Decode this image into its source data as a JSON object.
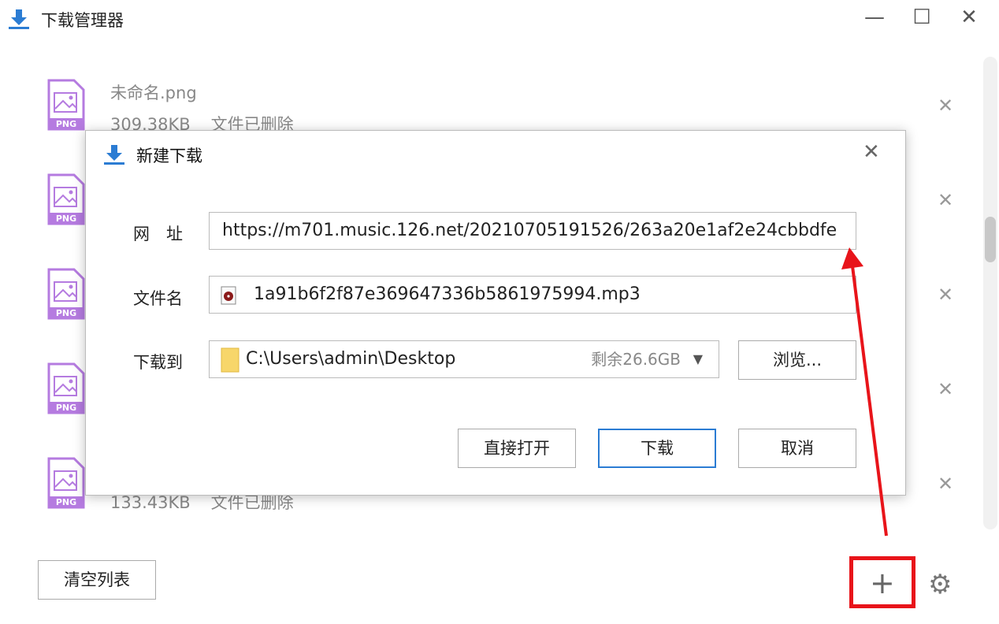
{
  "window": {
    "title": "下载管理器",
    "icon": "download-icon",
    "controls": [
      "minimize-icon",
      "maximize-icon",
      "close-icon"
    ]
  },
  "list": [
    {
      "name": "未命名.png",
      "size": "309.38KB",
      "status": "文件已删除",
      "type": "PNG"
    },
    {
      "name": "",
      "size": "",
      "status": "",
      "type": "PNG"
    },
    {
      "name": "",
      "size": "",
      "status": "",
      "type": "PNG"
    },
    {
      "name": "",
      "size": "",
      "status": "",
      "type": "PNG"
    },
    {
      "name": "",
      "size": "133.43KB",
      "status": "文件已删除",
      "type": "PNG"
    }
  ],
  "dialog": {
    "title": "新建下载",
    "url_label": "网　址",
    "url_value": "https://m701.music.126.net/20210705191526/263a20e1af2e24cbbdfe",
    "filename_label": "文件名",
    "filename_value": "1a91b6f2f87e369647336b5861975994.mp3",
    "saveto_label": "下载到",
    "saveto_value": "C:\\Users\\admin\\Desktop",
    "free_space": "剩余26.6GB",
    "browse": "浏览...",
    "open_direct": "直接打开",
    "download": "下载",
    "cancel": "取消"
  },
  "footer": {
    "clear_list": "清空列表",
    "add_icon": "plus-icon",
    "settings_icon": "gear-icon"
  },
  "colors": {
    "accent": "#2b7cd3",
    "png_purple": "#b57be0",
    "annotation_red": "#e8141a"
  }
}
